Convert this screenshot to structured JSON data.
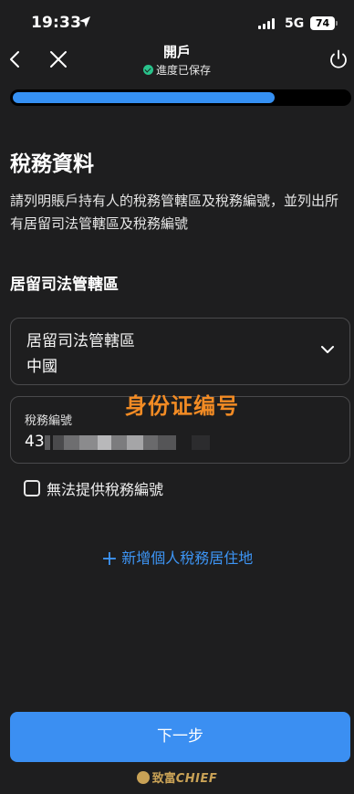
{
  "status_bar": {
    "time": "19:33",
    "network": "5G",
    "battery": "74"
  },
  "nav": {
    "title": "開戶",
    "subtitle": "進度已保存"
  },
  "progress": {
    "fraction": 0.78
  },
  "page": {
    "heading": "稅務資料",
    "description": "請列明賬戶持有人的稅務管轄區及稅務編號，並列出所有居留司法管轄區及稅務編號",
    "section_label": "居留司法管轄區"
  },
  "jurisdiction_field": {
    "label": "居留司法管轄區",
    "value": "中國"
  },
  "tin_field": {
    "label": "稅務編號",
    "value_prefix": "43"
  },
  "watermark": "身份证编号",
  "checkbox": {
    "label": "無法提供稅務編號",
    "checked": false
  },
  "add_link": {
    "label": "新增個人稅務居住地"
  },
  "next_button": {
    "label": "下一步"
  },
  "brand": {
    "cn": "致富",
    "en": "CHIEF"
  },
  "colors": {
    "accent": "#3b8ff2",
    "saved_dot": "#29c28b",
    "watermark": "#f28b24",
    "brand": "#c9a256"
  },
  "icons": [
    "location-arrow-icon",
    "signal-icon",
    "back-icon",
    "close-icon",
    "check-circle-icon",
    "power-icon",
    "chevron-down-icon",
    "checkbox-icon",
    "plus-icon"
  ]
}
